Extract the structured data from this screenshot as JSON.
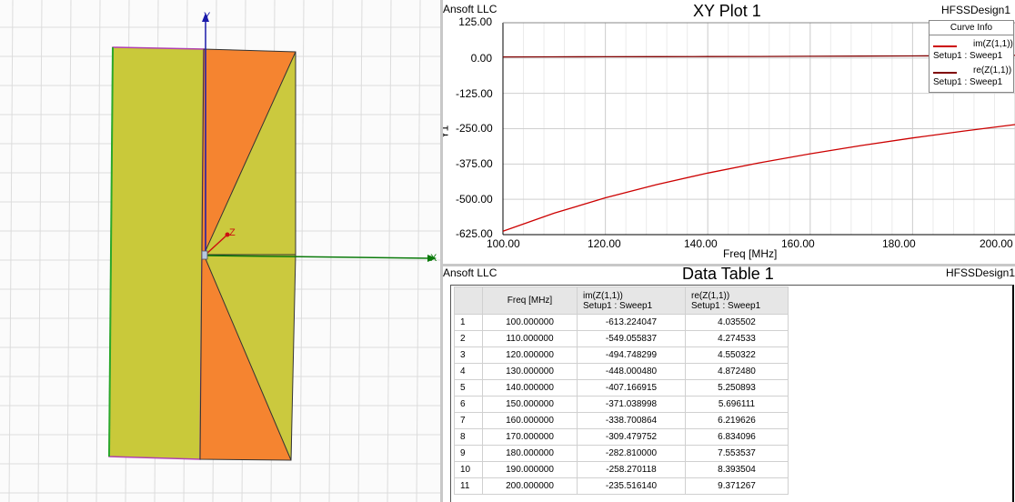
{
  "viewport": {
    "axis_y_label": "Y",
    "axis_x_label": "X",
    "axis_z_label": "Z"
  },
  "plot": {
    "company": "Ansoft LLC",
    "title": "XY Plot 1",
    "design": "HFSSDesign1",
    "ylabel": "Y1",
    "xlabel": "Freq [MHz]",
    "yticks": [
      "125.00",
      "0.00",
      "-125.00",
      "-250.00",
      "-375.00",
      "-500.00",
      "-625.00"
    ],
    "xticks": [
      "100.00",
      "120.00",
      "140.00",
      "160.00",
      "180.00",
      "200.00"
    ],
    "legend": {
      "header": "Curve Info",
      "items": [
        {
          "name": "im(Z(1,1))",
          "setup": "Setup1 : Sweep1",
          "color": "#cc0000"
        },
        {
          "name": "re(Z(1,1))",
          "setup": "Setup1 : Sweep1",
          "color": "#800000"
        }
      ]
    }
  },
  "chart_data": {
    "type": "line",
    "title": "XY Plot 1",
    "xlabel": "Freq [MHz]",
    "ylabel": "Y1",
    "xlim": [
      100,
      200
    ],
    "ylim": [
      -625,
      125
    ],
    "grid": true,
    "legend_position": "top-right",
    "x": [
      100,
      110,
      120,
      130,
      140,
      150,
      160,
      170,
      180,
      190,
      200
    ],
    "series": [
      {
        "name": "im(Z(1,1))",
        "color": "#cc0000",
        "values": [
          -613.224,
          -549.0559,
          -494.7483,
          -448.0005,
          -407.167,
          -371.039,
          -338.7009,
          -309.4798,
          -282.81,
          -258.2701,
          -235.5161
        ]
      },
      {
        "name": "re(Z(1,1))",
        "color": "#800000",
        "values": [
          4.035502,
          4.274533,
          4.550322,
          4.87248,
          5.250893,
          5.696111,
          6.219626,
          6.834096,
          7.553537,
          8.393504,
          9.371267
        ]
      }
    ]
  },
  "table": {
    "company": "Ansoft LLC",
    "title": "Data Table 1",
    "design": "HFSSDesign1",
    "headers": [
      {
        "line1": "Freq [MHz]",
        "line2": ""
      },
      {
        "line1": "im(Z(1,1))",
        "line2": "Setup1 : Sweep1"
      },
      {
        "line1": "re(Z(1,1))",
        "line2": "Setup1 : Sweep1"
      }
    ],
    "rows": [
      {
        "idx": "1",
        "freq": "100.000000",
        "im": "-613.224047",
        "re": "4.035502"
      },
      {
        "idx": "2",
        "freq": "110.000000",
        "im": "-549.055837",
        "re": "4.274533"
      },
      {
        "idx": "3",
        "freq": "120.000000",
        "im": "-494.748299",
        "re": "4.550322"
      },
      {
        "idx": "4",
        "freq": "130.000000",
        "im": "-448.000480",
        "re": "4.872480"
      },
      {
        "idx": "5",
        "freq": "140.000000",
        "im": "-407.166915",
        "re": "5.250893"
      },
      {
        "idx": "6",
        "freq": "150.000000",
        "im": "-371.038998",
        "re": "5.696111"
      },
      {
        "idx": "7",
        "freq": "160.000000",
        "im": "-338.700864",
        "re": "6.219626"
      },
      {
        "idx": "8",
        "freq": "170.000000",
        "im": "-309.479752",
        "re": "6.834096"
      },
      {
        "idx": "9",
        "freq": "180.000000",
        "im": "-282.810000",
        "re": "7.553537"
      },
      {
        "idx": "10",
        "freq": "190.000000",
        "im": "-258.270118",
        "re": "8.393504"
      },
      {
        "idx": "11",
        "freq": "200.000000",
        "im": "-235.516140",
        "re": "9.371267"
      }
    ]
  }
}
